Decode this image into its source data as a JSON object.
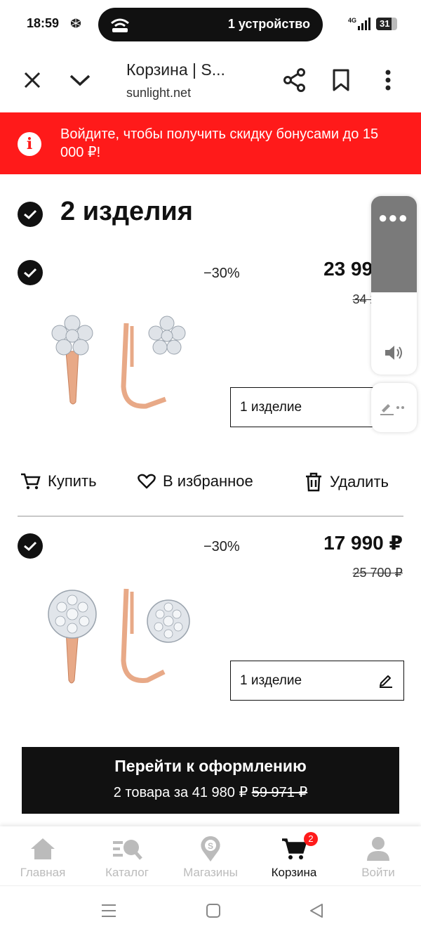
{
  "status_bar": {
    "time": "18:59",
    "connection_pill": "1 устройство",
    "network": "4G",
    "battery": "31"
  },
  "browser": {
    "title": "Корзина | S...",
    "url": "sunlight.net"
  },
  "banner": {
    "message": "Войдите, чтобы получить скидку бонусами до 15 000 ₽!",
    "color": "#ff1a1a"
  },
  "cart": {
    "headline": "2 изделия",
    "items": [
      {
        "discount": "−30%",
        "price": "23 990 ₽",
        "old_price": "34 271 ₽",
        "quantity": "1 изделие"
      },
      {
        "discount": "−30%",
        "price": "17 990 ₽",
        "old_price": "25 700 ₽",
        "quantity": "1 изделие"
      }
    ],
    "actions": {
      "buy": "Купить",
      "favorite": "В избранное",
      "delete": "Удалить"
    }
  },
  "checkout": {
    "button": "Перейти к оформлению",
    "summary_prefix": "2 товара за 41 980 ₽",
    "summary_old": "59 971 ₽"
  },
  "bottom_nav": {
    "items": [
      {
        "label": "Главная",
        "icon": "home-icon"
      },
      {
        "label": "Каталог",
        "icon": "catalog-icon"
      },
      {
        "label": "Магазины",
        "icon": "stores-icon"
      },
      {
        "label": "Корзина",
        "icon": "cart-icon",
        "badge": "2",
        "active": true
      },
      {
        "label": "Войти",
        "icon": "user-icon"
      }
    ]
  },
  "colors": {
    "accent": "#ff1a1a",
    "text": "#111111",
    "inactive": "#bbbbbb"
  }
}
